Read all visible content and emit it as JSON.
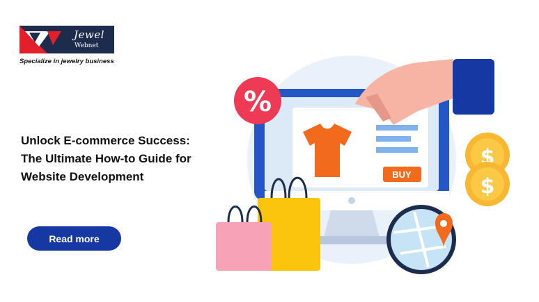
{
  "brand": {
    "name": "Jewel",
    "sub": "Webnet",
    "tagline": "Specialize in jewelry business"
  },
  "hero": {
    "headline_lines": [
      "Unlock E-commerce Success:",
      "The Ultimate How-to Guide for",
      "Website Development"
    ],
    "cta_label": "Read more"
  },
  "illustration": {
    "discount_symbol": "%",
    "buy_label": "BUY",
    "coin_symbol": "$"
  },
  "colors": {
    "brand_navy": "#1d2c4c",
    "cta_blue": "#1638a3",
    "accent_orange": "#f26a1b",
    "discount_red": "#ee3a55",
    "coin_yellow": "#f7b731"
  }
}
